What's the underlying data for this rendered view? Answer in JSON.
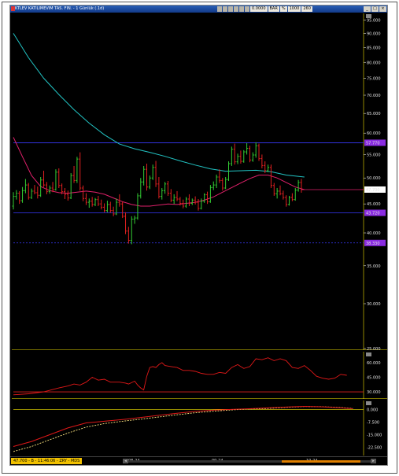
{
  "window": {
    "title": "KTLEV KATILIMEVIM TAS. FIN. - 1 Günlük (.1d)",
    "toolbar_fields": [
      "0.0000",
      "BAR",
      "%",
      "1000",
      "260"
    ],
    "buttons": {
      "minimize": "_",
      "maximize": "□",
      "close": "×"
    }
  },
  "colors": {
    "background": "#000000",
    "candle_up": "#33cc33",
    "candle_down": "#e02020",
    "ma_short": "#e0206a",
    "ma_long": "#22c4c4",
    "level_line": "#3a3aff",
    "level_badge": "#8a2be2",
    "price_badge": "#ffffff",
    "rsi": "#e01818",
    "macd": "#e01818",
    "signal": "#ffe680",
    "panel_line": "#f0e000",
    "status": "#f0c000",
    "scrollbar": "#e08000"
  },
  "price_axis": [
    "95.000",
    "90.000",
    "85.000",
    "80.000",
    "75.000",
    "70.000",
    "65.000",
    "60.000",
    "55.000",
    "50.000",
    "45.000",
    "40.000",
    "35.000",
    "30.000",
    "25.000"
  ],
  "levels": [
    {
      "value": 57.7,
      "label": "57.770",
      "style": "solid"
    },
    {
      "value": 43.4,
      "label": "43.720",
      "style": "solid"
    },
    {
      "value": 38.4,
      "label": "38.330",
      "style": "dashed"
    }
  ],
  "last_price": {
    "value": 47.7,
    "label": "47.700"
  },
  "rsi_axis": [
    "60.000",
    "45.000",
    "30.000"
  ],
  "macd_axis": [
    "0.000",
    "-7.500",
    "-15.000",
    "-22.500"
  ],
  "x_labels": [
    "08-24",
    "09-24",
    "10-24"
  ],
  "status": {
    "text": "47.700 - B - 11:46:06 - ZRY - MDS"
  },
  "chart_data": {
    "type": "candlestick",
    "x_range": [
      0,
      115
    ],
    "y_range": [
      25,
      97
    ],
    "y_scale": "log",
    "candles": [
      [
        44.6,
        47.2,
        44.0,
        46.4
      ],
      [
        46.4,
        47.6,
        45.8,
        47.0
      ],
      [
        47.0,
        47.4,
        45.0,
        45.6
      ],
      [
        45.6,
        48.2,
        45.2,
        47.5
      ],
      [
        47.5,
        49.8,
        47.0,
        48.6
      ],
      [
        48.6,
        49.0,
        45.8,
        46.2
      ],
      [
        46.2,
        47.9,
        45.9,
        47.4
      ],
      [
        47.4,
        48.6,
        46.8,
        47.1
      ],
      [
        47.1,
        48.3,
        46.0,
        46.6
      ],
      [
        46.6,
        50.2,
        46.3,
        49.6
      ],
      [
        49.6,
        51.5,
        48.2,
        48.6
      ],
      [
        48.6,
        49.2,
        46.8,
        47.3
      ],
      [
        47.3,
        48.5,
        46.9,
        48.0
      ],
      [
        48.0,
        49.2,
        47.2,
        47.7
      ],
      [
        47.7,
        51.8,
        47.5,
        51.2
      ],
      [
        51.2,
        52.0,
        48.0,
        48.5
      ],
      [
        48.5,
        48.9,
        46.8,
        47.3
      ],
      [
        47.3,
        48.0,
        45.9,
        46.8
      ],
      [
        46.8,
        47.5,
        45.6,
        46.1
      ],
      [
        46.1,
        51.0,
        45.9,
        50.5
      ],
      [
        50.5,
        52.5,
        49.0,
        49.5
      ],
      [
        49.5,
        54.5,
        49.0,
        54.0
      ],
      [
        54.0,
        55.5,
        47.5,
        48.0
      ],
      [
        48.0,
        48.5,
        45.5,
        46.0
      ],
      [
        46.0,
        47.0,
        44.8,
        45.3
      ],
      [
        45.3,
        46.0,
        44.3,
        45.5
      ],
      [
        45.5,
        46.3,
        44.5,
        44.9
      ],
      [
        44.9,
        46.1,
        44.6,
        45.8
      ],
      [
        45.8,
        46.5,
        44.6,
        45.0
      ],
      [
        45.0,
        45.8,
        44.0,
        44.4
      ],
      [
        44.4,
        45.1,
        43.5,
        43.8
      ],
      [
        43.8,
        45.6,
        43.5,
        44.9
      ],
      [
        44.9,
        45.4,
        43.4,
        43.8
      ],
      [
        43.8,
        44.5,
        42.8,
        43.2
      ],
      [
        43.2,
        46.0,
        43.0,
        45.3
      ],
      [
        45.3,
        46.8,
        44.5,
        45.0
      ],
      [
        45.0,
        45.4,
        42.5,
        42.8
      ],
      [
        42.8,
        43.5,
        39.8,
        40.3
      ],
      [
        40.3,
        41.0,
        38.3,
        38.8
      ],
      [
        38.8,
        42.8,
        38.2,
        42.3
      ],
      [
        42.3,
        42.9,
        41.5,
        42.5
      ],
      [
        42.5,
        47.0,
        42.2,
        46.5
      ],
      [
        46.5,
        50.0,
        46.0,
        49.2
      ],
      [
        49.2,
        52.5,
        48.5,
        51.8
      ],
      [
        51.8,
        53.0,
        47.5,
        48.2
      ],
      [
        48.2,
        50.5,
        47.8,
        50.0
      ],
      [
        50.0,
        52.8,
        49.6,
        52.2
      ],
      [
        52.2,
        53.6,
        48.2,
        48.8
      ],
      [
        48.8,
        50.2,
        46.0,
        46.4
      ],
      [
        46.4,
        48.0,
        45.8,
        47.5
      ],
      [
        47.5,
        49.2,
        46.9,
        48.8
      ],
      [
        48.8,
        49.4,
        46.5,
        47.0
      ],
      [
        47.0,
        47.8,
        45.3,
        45.7
      ],
      [
        45.7,
        46.8,
        45.0,
        46.2
      ],
      [
        46.2,
        47.4,
        45.5,
        45.9
      ],
      [
        45.9,
        46.3,
        44.7,
        45.1
      ],
      [
        45.1,
        45.8,
        44.2,
        44.6
      ],
      [
        44.6,
        46.3,
        44.3,
        45.9
      ],
      [
        45.9,
        46.8,
        44.6,
        45.1
      ],
      [
        45.1,
        46.0,
        44.8,
        45.7
      ],
      [
        45.7,
        46.4,
        44.9,
        45.3
      ],
      [
        45.3,
        45.9,
        43.8,
        44.2
      ],
      [
        44.2,
        46.0,
        44.0,
        45.5
      ],
      [
        45.5,
        47.0,
        45.2,
        46.7
      ],
      [
        46.7,
        47.3,
        45.0,
        45.4
      ],
      [
        45.4,
        48.6,
        45.2,
        48.1
      ],
      [
        48.1,
        49.3,
        47.6,
        48.6
      ],
      [
        48.6,
        50.7,
        48.0,
        50.2
      ],
      [
        50.2,
        51.8,
        49.0,
        49.5
      ],
      [
        49.5,
        50.0,
        47.5,
        48.0
      ],
      [
        48.0,
        50.2,
        47.8,
        49.7
      ],
      [
        49.7,
        53.5,
        49.4,
        53.0
      ],
      [
        53.0,
        56.8,
        52.5,
        56.2
      ],
      [
        56.2,
        57.5,
        52.8,
        53.4
      ],
      [
        53.4,
        55.2,
        52.9,
        54.6
      ],
      [
        54.6,
        55.9,
        53.0,
        53.5
      ],
      [
        53.5,
        56.0,
        53.2,
        55.6
      ],
      [
        55.6,
        57.6,
        55.0,
        56.4
      ],
      [
        56.4,
        57.0,
        53.3,
        53.8
      ],
      [
        53.8,
        55.5,
        53.4,
        54.9
      ],
      [
        54.9,
        57.8,
        54.3,
        57.0
      ],
      [
        57.0,
        57.5,
        53.6,
        54.1
      ],
      [
        54.1,
        55.0,
        52.0,
        52.6
      ],
      [
        52.6,
        53.5,
        51.0,
        51.5
      ],
      [
        51.5,
        52.8,
        51.2,
        52.2
      ],
      [
        52.2,
        52.8,
        48.0,
        48.5
      ],
      [
        48.5,
        49.0,
        46.5,
        46.9
      ],
      [
        46.9,
        48.0,
        46.0,
        47.4
      ],
      [
        47.4,
        48.5,
        46.6,
        46.9
      ],
      [
        46.9,
        47.5,
        45.8,
        46.2
      ],
      [
        46.2,
        46.6,
        44.5,
        44.9
      ],
      [
        44.9,
        46.5,
        44.7,
        46.2
      ],
      [
        46.2,
        47.0,
        45.5,
        45.8
      ],
      [
        45.8,
        48.0,
        45.6,
        47.6
      ],
      [
        47.6,
        49.6,
        47.3,
        49.1
      ],
      [
        49.1,
        49.8,
        47.1,
        47.7
      ]
    ],
    "ma_short": [
      [
        0,
        59.0
      ],
      [
        3,
        54.5
      ],
      [
        6,
        50.5
      ],
      [
        9,
        48.3
      ],
      [
        12,
        47.5
      ],
      [
        15,
        47.1
      ],
      [
        18,
        47.0
      ],
      [
        21,
        47.2
      ],
      [
        24,
        47.4
      ],
      [
        27,
        47.2
      ],
      [
        30,
        46.8
      ],
      [
        33,
        46.1
      ],
      [
        36,
        45.4
      ],
      [
        39,
        44.9
      ],
      [
        42,
        44.6
      ],
      [
        45,
        44.6
      ],
      [
        48,
        44.8
      ],
      [
        51,
        45.0
      ],
      [
        54,
        44.9
      ],
      [
        57,
        45.1
      ],
      [
        60,
        45.3
      ],
      [
        63,
        45.7
      ],
      [
        66,
        46.3
      ],
      [
        69,
        47.2
      ],
      [
        72,
        48.1
      ],
      [
        75,
        49.0
      ],
      [
        78,
        49.9
      ],
      [
        81,
        50.6
      ],
      [
        84,
        50.6
      ],
      [
        87,
        50.0
      ],
      [
        90,
        49.1
      ],
      [
        93,
        48.2
      ],
      [
        96,
        47.7
      ]
    ],
    "ma_long": [
      [
        0,
        90.0
      ],
      [
        5,
        81.5
      ],
      [
        10,
        75.0
      ],
      [
        15,
        70.2
      ],
      [
        20,
        66.0
      ],
      [
        25,
        62.5
      ],
      [
        30,
        59.6
      ],
      [
        35,
        57.4
      ],
      [
        40,
        56.3
      ],
      [
        45,
        55.5
      ],
      [
        50,
        54.6
      ],
      [
        55,
        53.6
      ],
      [
        60,
        52.7
      ],
      [
        65,
        51.9
      ],
      [
        70,
        51.4
      ],
      [
        75,
        51.5
      ],
      [
        80,
        51.6
      ],
      [
        85,
        51.3
      ],
      [
        90,
        50.6
      ],
      [
        96,
        50.2
      ]
    ],
    "rsi": [
      [
        0,
        27
      ],
      [
        5,
        28
      ],
      [
        10,
        30
      ],
      [
        15,
        34
      ],
      [
        18,
        36
      ],
      [
        20,
        38
      ],
      [
        22,
        37
      ],
      [
        24,
        40
      ],
      [
        26,
        45
      ],
      [
        28,
        42
      ],
      [
        30,
        43
      ],
      [
        32,
        40
      ],
      [
        35,
        40
      ],
      [
        37,
        39
      ],
      [
        38,
        38
      ],
      [
        40,
        41
      ],
      [
        41,
        37
      ],
      [
        42,
        34
      ],
      [
        43,
        32
      ],
      [
        44,
        46
      ],
      [
        45,
        55
      ],
      [
        46,
        56
      ],
      [
        47,
        55
      ],
      [
        48,
        58
      ],
      [
        49,
        60
      ],
      [
        50,
        57
      ],
      [
        52,
        56
      ],
      [
        54,
        55
      ],
      [
        56,
        52
      ],
      [
        58,
        52
      ],
      [
        60,
        51
      ],
      [
        62,
        49
      ],
      [
        64,
        48
      ],
      [
        66,
        48
      ],
      [
        68,
        50
      ],
      [
        70,
        49
      ],
      [
        72,
        55
      ],
      [
        74,
        58
      ],
      [
        75,
        56
      ],
      [
        76,
        54
      ],
      [
        78,
        56
      ],
      [
        80,
        64
      ],
      [
        82,
        63
      ],
      [
        84,
        65
      ],
      [
        86,
        62
      ],
      [
        88,
        64
      ],
      [
        90,
        62
      ],
      [
        92,
        55
      ],
      [
        94,
        54
      ],
      [
        96,
        57
      ],
      [
        98,
        52
      ],
      [
        100,
        46
      ],
      [
        102,
        44
      ],
      [
        104,
        43
      ],
      [
        106,
        44
      ],
      [
        108,
        48
      ],
      [
        110,
        47
      ]
    ],
    "macd": [
      [
        0,
        -22.0
      ],
      [
        6,
        -19.0
      ],
      [
        12,
        -15.0
      ],
      [
        18,
        -11.0
      ],
      [
        24,
        -8.0
      ],
      [
        30,
        -7.0
      ],
      [
        36,
        -6.0
      ],
      [
        42,
        -4.8
      ],
      [
        48,
        -3.5
      ],
      [
        54,
        -2.3
      ],
      [
        60,
        -1.2
      ],
      [
        66,
        -0.4
      ],
      [
        72,
        0.0
      ],
      [
        78,
        0.4
      ],
      [
        84,
        0.9
      ],
      [
        90,
        1.4
      ],
      [
        96,
        1.8
      ],
      [
        102,
        1.5
      ],
      [
        108,
        0.9
      ],
      [
        112,
        0.4
      ]
    ],
    "signal": [
      [
        0,
        -25.0
      ],
      [
        6,
        -22.0
      ],
      [
        12,
        -18.0
      ],
      [
        18,
        -14.0
      ],
      [
        24,
        -10.5
      ],
      [
        30,
        -8.4
      ],
      [
        36,
        -7.0
      ],
      [
        42,
        -5.8
      ],
      [
        48,
        -4.5
      ],
      [
        54,
        -3.2
      ],
      [
        60,
        -2.0
      ],
      [
        66,
        -1.1
      ],
      [
        72,
        -0.3
      ],
      [
        78,
        0.2
      ],
      [
        84,
        0.6
      ],
      [
        90,
        1.2
      ],
      [
        96,
        1.7
      ],
      [
        102,
        1.6
      ],
      [
        108,
        1.1
      ],
      [
        112,
        0.6
      ]
    ]
  }
}
